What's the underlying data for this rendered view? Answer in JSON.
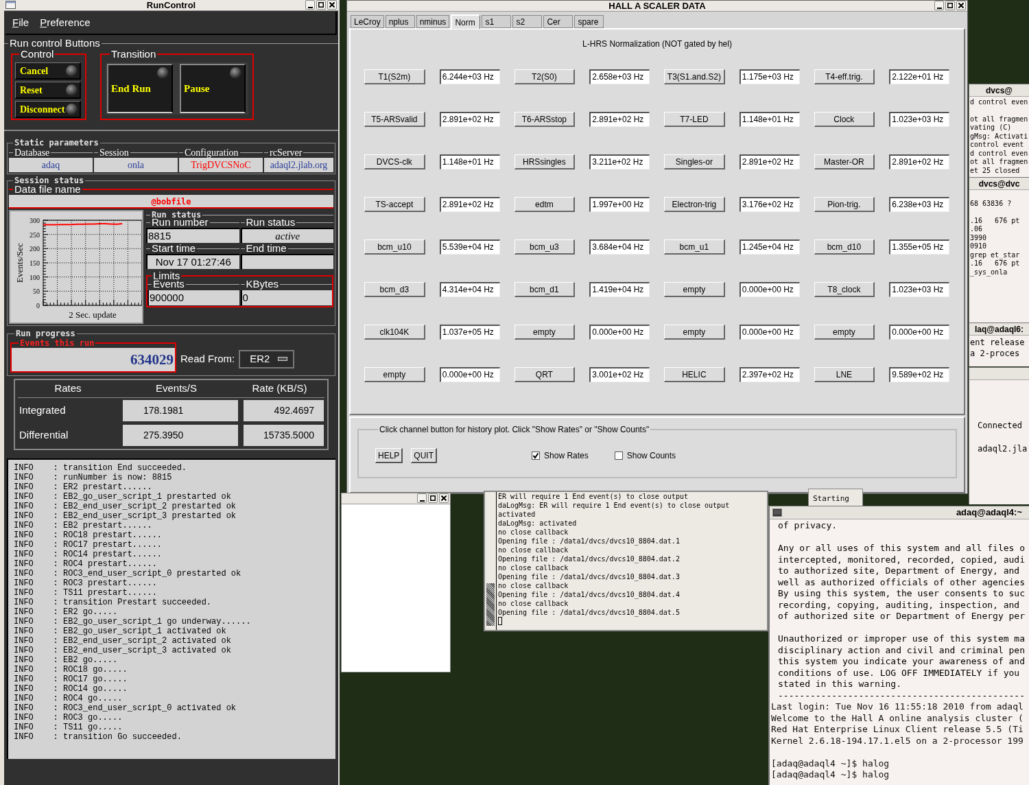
{
  "run_control": {
    "title": "RunControl",
    "menu": [
      "File",
      "Preference"
    ],
    "buttons_group": "Run control Buttons",
    "control": {
      "label": "Control",
      "buttons": [
        "Cancel",
        "Reset",
        "Disconnect"
      ]
    },
    "transition": {
      "label": "Transition",
      "buttons": [
        "End Run",
        "Pause"
      ]
    },
    "static_parameters": {
      "label": "Static parameters",
      "fields": [
        {
          "label": "Database",
          "value": "adaq",
          "color": "#2a3f9a"
        },
        {
          "label": "Session",
          "value": "onla",
          "color": "#2a3f9a"
        },
        {
          "label": "Configuration",
          "value": "TrigDVCSNoC",
          "color": "#ff0000"
        },
        {
          "label": "rcServer",
          "value": "adaql2.jlab.org",
          "color": "#2a3f9a"
        }
      ]
    },
    "session_status": {
      "label": "Session status",
      "data_file_label": "Data file name",
      "data_file": "@bobfile",
      "chart_data": {
        "type": "line",
        "grid": true,
        "xlabel": "2 Sec. update",
        "ylabel": "Events/Sec",
        "ylim": [
          0,
          300
        ],
        "yticks": [
          0,
          50,
          100,
          150,
          200,
          250,
          300
        ],
        "series": [
          {
            "color": "#ff0000",
            "values": [
              284,
              284,
              284,
              285,
              285,
              285,
              286,
              286,
              287,
              287,
              288,
              288,
              287,
              286,
              288
            ]
          }
        ]
      },
      "run_status": {
        "label": "Run status",
        "run_number_label": "Run number",
        "run_number": "8815",
        "run_state_label": "Run status",
        "run_state": "active",
        "start_label": "Start time",
        "start_time": "Nov 17 01:27:46",
        "end_label": "End time"
      },
      "limits": {
        "label": "Limits",
        "events_label": "Events",
        "events": "900000",
        "kbytes_label": "KBytes",
        "kbytes": "0"
      }
    },
    "run_progress": {
      "label": "Run progress",
      "events_label": "Events this run",
      "events": "634029",
      "read_from_label": "Read From:",
      "read_from": "ER2"
    },
    "rates": {
      "columns": [
        "Rates",
        "Events/S",
        "Rate (KB/S)"
      ],
      "rows": [
        {
          "label": "Integrated",
          "events": "178.1981",
          "rate": "492.4697"
        },
        {
          "label": "Differential",
          "events": "275.3950",
          "rate": "15735.5000"
        }
      ]
    },
    "log": [
      "INFO    : transition End succeeded.",
      "INFO    : runNumber is now: 8815",
      "INFO    : ER2 prestart......",
      "INFO    : EB2_go_user_script_1 prestarted ok",
      "INFO    : EB2_end_user_script_2 prestarted ok",
      "INFO    : EB2_end_user_script_3 prestarted ok",
      "INFO    : EB2 prestart......",
      "INFO    : ROC18 prestart......",
      "INFO    : ROC17 prestart......",
      "INFO    : ROC14 prestart......",
      "INFO    : ROC4 prestart......",
      "INFO    : ROC3_end_user_script_0 prestarted ok",
      "INFO    : ROC3 prestart......",
      "INFO    : TS11 prestart......",
      "INFO    : transition Prestart succeeded.",
      "INFO    : ER2 go.....",
      "INFO    : EB2_go_user_script_1 go underway......",
      "INFO    : EB2_go_user_script_1 activated ok",
      "INFO    : EB2_end_user_script_2 activated ok",
      "INFO    : EB2_end_user_script_3 activated ok",
      "INFO    : EB2 go.....",
      "INFO    : ROC18 go.....",
      "INFO    : ROC17 go.....",
      "INFO    : ROC14 go.....",
      "INFO    : ROC4 go.....",
      "INFO    : ROC3_end_user_script_0 activated ok",
      "INFO    : ROC3 go.....",
      "INFO    : TS11 go.....",
      "INFO    : transition Go succeeded."
    ]
  },
  "scaler": {
    "title": "HALL  A   SCALER   DATA",
    "tabs": [
      {
        "label": "LeCroy",
        "selected": false
      },
      {
        "label": "nplus",
        "selected": false
      },
      {
        "label": "nminus",
        "selected": false
      },
      {
        "label": "Norm",
        "selected": true
      },
      {
        "label": "s1",
        "selected": false
      },
      {
        "label": "s2",
        "selected": false
      },
      {
        "label": "Cer",
        "selected": false
      },
      {
        "label": "spare",
        "selected": false
      }
    ],
    "subtitle": "L-HRS Normalization (NOT gated by hel)",
    "rows": [
      [
        {
          "channel": "T1(S2m)",
          "rate": "6.244e+03 Hz"
        },
        {
          "channel": "T2(S0)",
          "rate": "2.658e+03 Hz"
        },
        {
          "channel": "T3(S1.and.S2)",
          "rate": "1.175e+03 Hz"
        },
        {
          "channel": "T4-eff.trig.",
          "rate": "2.122e+01 Hz"
        }
      ],
      [
        {
          "channel": "T5-ARSvalid",
          "rate": "2.891e+02 Hz"
        },
        {
          "channel": "T6-ARSstop",
          "rate": "2.891e+02 Hz"
        },
        {
          "channel": "T7-LED",
          "rate": "1.148e+01 Hz"
        },
        {
          "channel": "Clock",
          "rate": "1.023e+03 Hz"
        }
      ],
      [
        {
          "channel": "DVCS-clk",
          "rate": "1.148e+01 Hz"
        },
        {
          "channel": "HRSsingles",
          "rate": "3.211e+02 Hz"
        },
        {
          "channel": "Singles-or",
          "rate": "2.891e+02 Hz"
        },
        {
          "channel": "Master-OR",
          "rate": "2.891e+02 Hz"
        }
      ],
      [
        {
          "channel": "TS-accept",
          "rate": "2.891e+02 Hz"
        },
        {
          "channel": "edtm",
          "rate": "1.997e+00 Hz"
        },
        {
          "channel": "Electron-trig",
          "rate": "3.176e+02 Hz"
        },
        {
          "channel": "Pion-trig.",
          "rate": "6.238e+03 Hz"
        }
      ],
      [
        {
          "channel": "bcm_u10",
          "rate": "5.539e+04 Hz"
        },
        {
          "channel": "bcm_u3",
          "rate": "3.684e+04 Hz"
        },
        {
          "channel": "bcm_u1",
          "rate": "1.245e+04 Hz"
        },
        {
          "channel": "bcm_d10",
          "rate": "1.355e+05 Hz"
        }
      ],
      [
        {
          "channel": "bcm_d3",
          "rate": "4.314e+04 Hz"
        },
        {
          "channel": "bcm_d1",
          "rate": "1.419e+04 Hz"
        },
        {
          "channel": "empty",
          "rate": "0.000e+00 Hz"
        },
        {
          "channel": "T8_clock",
          "rate": "1.023e+03 Hz"
        }
      ],
      [
        {
          "channel": "clk104K",
          "rate": "1.037e+05 Hz"
        },
        {
          "channel": "empty",
          "rate": "0.000e+00 Hz"
        },
        {
          "channel": "empty",
          "rate": "0.000e+00 Hz"
        },
        {
          "channel": "empty",
          "rate": "0.000e+00 Hz"
        }
      ],
      [
        {
          "channel": "empty",
          "rate": "0.000e+00 Hz"
        },
        {
          "channel": "QRT",
          "rate": "3.001e+02 Hz"
        },
        {
          "channel": "HELIC",
          "rate": "2.397e+02 Hz"
        },
        {
          "channel": "LNE",
          "rate": "9.589e+02 Hz"
        }
      ]
    ],
    "hint": "Click channel button for history plot.  Click \"Show Rates\" or \"Show Counts\"",
    "buttons": [
      "HELP",
      "QUIT"
    ],
    "options": [
      {
        "label": "Show Rates",
        "checked": true
      },
      {
        "label": "Show Counts",
        "checked": false
      }
    ]
  },
  "log_terminal": [
    "ER will require 1 End event(s) to close output",
    "daLogMsg: ER will require 1 End event(s) to close output",
    "activated",
    "daLogMsg: activated",
    "no close callback",
    "Opening file : /data1/dvcs/dvcs10_8804.dat.1",
    "no close callback",
    "Opening file : /data1/dvcs/dvcs10_8804.dat.2",
    "no close callback",
    "Opening file : /data1/dvcs/dvcs10_8804.dat.3",
    "no close callback",
    "Opening file : /data1/dvcs/dvcs10_8804.dat.4",
    "no close callback",
    "Opening file : /data1/dvcs/dvcs10_8804.dat.5"
  ],
  "hidden_window_text": "Starting",
  "side_windows": [
    {
      "title": "dvcs@",
      "paragraphs": [
        [
          "d control even"
        ],
        [
          "ot all fragmen",
          "vating (C)",
          "gMsg: Activati",
          "control event",
          "d control even",
          "ot all fragmen",
          "et 25 closed"
        ]
      ]
    },
    {
      "title": "dvcs@dvc",
      "paragraphs": [
        [
          "68 63836 ?"
        ],
        [
          ".16   676 pt",
          ".06",
          "3990",
          "0910",
          "grep et_star",
          ".16   676 pt",
          "_sys_onla"
        ]
      ]
    },
    {
      "title": "laq@adaql6:",
      "paragraphs": [
        [
          "ent release",
          "a 2-proces"
        ]
      ]
    },
    {
      "paragraphs": [
        [
          "Connected"
        ],
        [
          "adaql2.jla"
        ]
      ]
    }
  ],
  "terminal": {
    "title": "adaq@adaql4:~",
    "paragraphs": [
      [
        {
          "text": "of privacy.",
          "indented": true
        }
      ],
      [
        {
          "text": "Any or all uses of this system and all files o",
          "indented": true
        },
        {
          "text": "intercepted, monitored, recorded, copied, audi",
          "indented": true
        },
        {
          "text": "to authorized site, Department of Energy, and",
          "indented": true
        },
        {
          "text": "well as authorized officials of other agencies",
          "indented": true
        },
        {
          "text": "By using this system, the user consents to suc",
          "indented": true
        },
        {
          "text": "recording, copying, auditing, inspection, and",
          "indented": true
        },
        {
          "text": "of authorized site or Department of Energy per",
          "indented": true
        }
      ],
      [
        {
          "text": "Unauthorized or improper use of this system ma",
          "indented": true
        },
        {
          "text": "disciplinary action and civil and criminal pen",
          "indented": true
        },
        {
          "text": "this system you indicate your awareness of and",
          "indented": true
        },
        {
          "text": "conditions of use. LOG OFF IMMEDIATELY if you",
          "indented": true
        },
        {
          "text": "stated in this warning.",
          "indented": true
        },
        {
          "text": "----------------------------------------------",
          "indented": true
        },
        {
          "text": "Last login: Tue Nov 16 11:55:18 2010 from adaql",
          "indented": false
        },
        {
          "text": "Welcome to the Hall A online analysis cluster (",
          "indented": false
        },
        {
          "text": "Red Hat Enterprise Linux Client release 5.5 (Ti",
          "indented": false
        },
        {
          "text": "Kernel 2.6.18-194.17.1.el5 on a 2-processor 199",
          "indented": false
        }
      ],
      [
        {
          "text": "[adaq@adaql4 ~]$ halog",
          "indented": false
        },
        {
          "text": "[adaq@adaql4 ~]$ halog",
          "indented": false
        }
      ]
    ]
  }
}
